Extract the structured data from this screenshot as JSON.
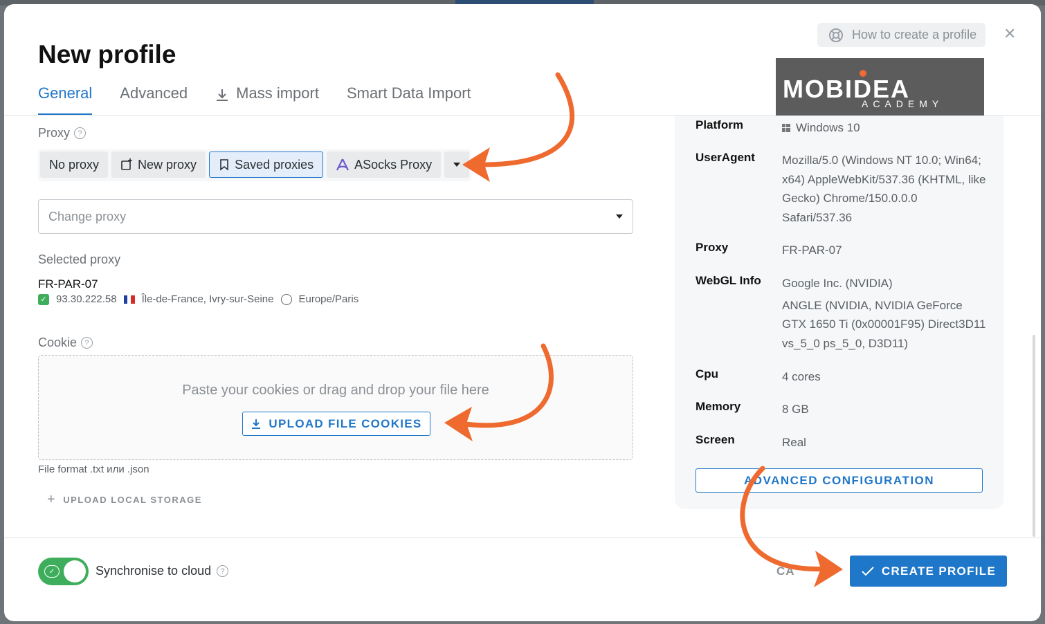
{
  "modal": {
    "title": "New profile",
    "help_link": "How to create a profile",
    "close_glyph": "✕"
  },
  "tabs": [
    {
      "label": "General",
      "active": true
    },
    {
      "label": "Advanced",
      "active": false
    },
    {
      "label": "Mass import",
      "active": false,
      "icon": "download-icon"
    },
    {
      "label": "Smart Data Import",
      "active": false
    }
  ],
  "logo": {
    "main": "MOBIDEA",
    "sub": "ACADEMY"
  },
  "proxy": {
    "label": "Proxy",
    "options": [
      {
        "label": "No proxy",
        "active": false
      },
      {
        "label": "New proxy",
        "active": false,
        "icon": "add-icon"
      },
      {
        "label": "Saved proxies",
        "active": true,
        "icon": "bookmark-icon"
      },
      {
        "label": "ASocks Proxy",
        "active": false,
        "icon": "asocks-icon"
      }
    ],
    "change_placeholder": "Change proxy",
    "selected_label": "Selected proxy",
    "selected_name": "FR-PAR-07",
    "selected_ip": "93.30.222.58",
    "selected_location": "Île-de-France, Ivry-sur-Seine",
    "selected_timezone": "Europe/Paris"
  },
  "cookie": {
    "label": "Cookie",
    "dropzone_text": "Paste your cookies or drag and drop your file here",
    "upload_button": "UPLOAD FILE COOKIES",
    "file_format": "File format .txt или .json",
    "local_storage": "UPLOAD LOCAL STORAGE"
  },
  "summary": {
    "platform_label": "Platform",
    "platform_value": "Windows 10",
    "useragent_label": "UserAgent",
    "useragent_value": "Mozilla/5.0 (Windows NT 10.0; Win64; x64) AppleWebKit/537.36 (KHTML, like Gecko) Chrome/150.0.0.0 Safari/537.36",
    "proxy_label": "Proxy",
    "proxy_value": "FR-PAR-07",
    "webgl_label": "WebGL Info",
    "webgl_vendor": "Google Inc. (NVIDIA)",
    "webgl_renderer": "ANGLE (NVIDIA, NVIDIA GeForce GTX 1650 Ti (0x00001F95) Direct3D11 vs_5_0 ps_5_0, D3D11)",
    "cpu_label": "Cpu",
    "cpu_value": "4 cores",
    "memory_label": "Memory",
    "memory_value": "8 GB",
    "screen_label": "Screen",
    "screen_value": "Real",
    "advanced_button": "ADVANCED CONFIGURATION"
  },
  "footer": {
    "sync_label": "Synchronise to cloud",
    "sync_enabled": true,
    "cancel_label": "CA",
    "create_label": "CREATE PROFILE"
  },
  "colors": {
    "accent": "#1f77c9",
    "success": "#3fae5c",
    "annotation": "#ee6a2f"
  }
}
